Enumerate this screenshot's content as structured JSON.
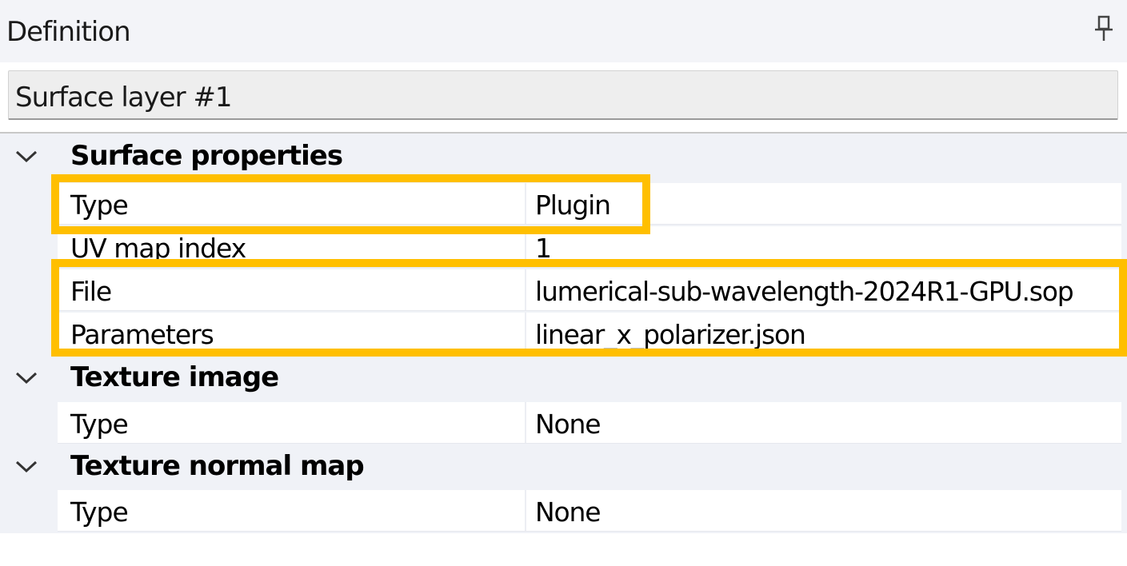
{
  "panel": {
    "title": "Definition",
    "pin_icon": "pin-icon"
  },
  "layer_selector": {
    "value": "Surface layer #1"
  },
  "categories": [
    {
      "label": "Surface properties",
      "expand_icon": "chevron-down-icon",
      "properties": [
        {
          "name": "Type",
          "value": "Plugin"
        },
        {
          "name": "UV map index",
          "value": "1"
        },
        {
          "name": "File",
          "value": "lumerical-sub-wavelength-2024R1-GPU.sop"
        },
        {
          "name": "Parameters",
          "value": "linear_x_polarizer.json"
        }
      ]
    },
    {
      "label": "Texture image",
      "expand_icon": "chevron-down-icon",
      "properties": [
        {
          "name": "Type",
          "value": "None"
        }
      ]
    },
    {
      "label": "Texture normal map",
      "expand_icon": "chevron-down-icon",
      "properties": [
        {
          "name": "Type",
          "value": "None"
        }
      ]
    }
  ],
  "colors": {
    "highlight": "#ffbf00",
    "grid_background": "#f0f2f7",
    "header_background": "#f3f4f8"
  }
}
